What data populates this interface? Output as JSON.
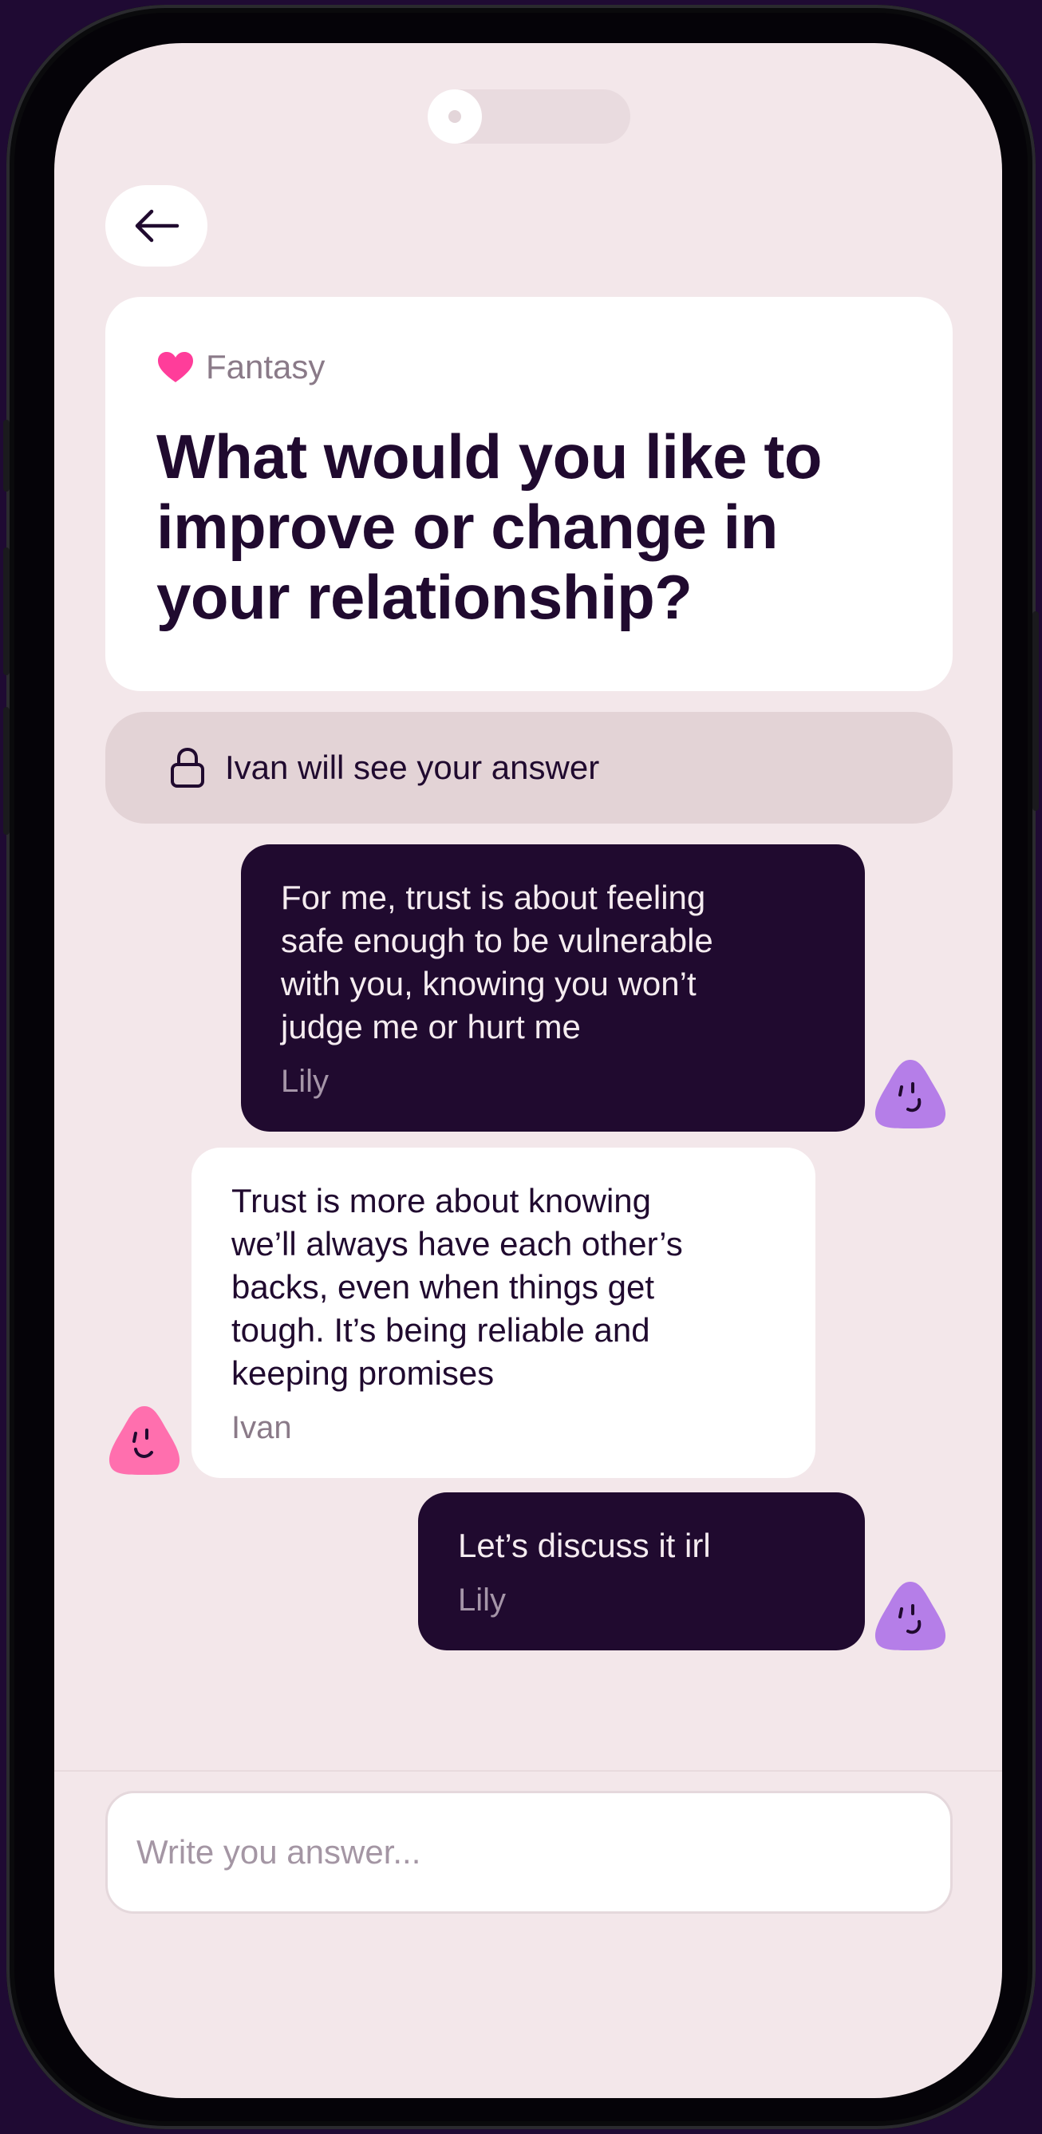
{
  "question": {
    "category": "Fantasy",
    "title": "What would you like to improve or change in your relationship?"
  },
  "privacy": {
    "text": "Ivan will see your answer"
  },
  "messages": [
    {
      "text": "For me, trust is about feeling\nsafe enough to be vulnerable\nwith you, knowing you won’t\njudge me or hurt me",
      "author": "Lily"
    },
    {
      "text": "Trust is more about knowing\nwe’ll always have each other’s\nbacks, even when things get\ntough. It’s being reliable and\nkeeping promises",
      "author": "Ivan"
    },
    {
      "text": "Let’s discuss it irl",
      "author": "Lily"
    }
  ],
  "composer": {
    "placeholder": "Write you answer...",
    "value": ""
  },
  "colors": {
    "background": "#f3e7ea",
    "dark_bubble": "#200a2f",
    "accent_heart": "#ff3d9a",
    "avatar_lily": "#b57ee8",
    "avatar_ivan": "#ff6fae"
  },
  "icons": {
    "back": "arrow-left-icon",
    "category": "heart-icon",
    "privacy": "lock-icon",
    "avatar": "smiley-blob-icon"
  }
}
